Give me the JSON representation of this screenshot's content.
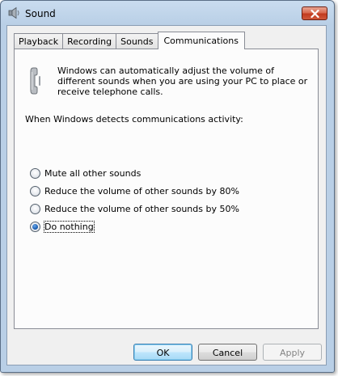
{
  "window": {
    "title": "Sound"
  },
  "tabs": [
    {
      "label": "Playback",
      "active": false
    },
    {
      "label": "Recording",
      "active": false
    },
    {
      "label": "Sounds",
      "active": false
    },
    {
      "label": "Communications",
      "active": true
    }
  ],
  "communications": {
    "description": "Windows can automatically adjust the volume of different sounds when you are using your PC to place or receive telephone calls.",
    "detect_label": "When Windows detects communications activity:",
    "options": [
      {
        "label": "Mute all other sounds",
        "checked": false
      },
      {
        "label": "Reduce the volume of other sounds by 80%",
        "checked": false
      },
      {
        "label": "Reduce the volume of other sounds by 50%",
        "checked": false
      },
      {
        "label": "Do nothing",
        "checked": true
      }
    ]
  },
  "buttons": {
    "ok": "OK",
    "cancel": "Cancel",
    "apply": "Apply"
  },
  "icons": {
    "title": "speaker-icon",
    "close": "close-icon",
    "phone": "telephone-icon"
  }
}
